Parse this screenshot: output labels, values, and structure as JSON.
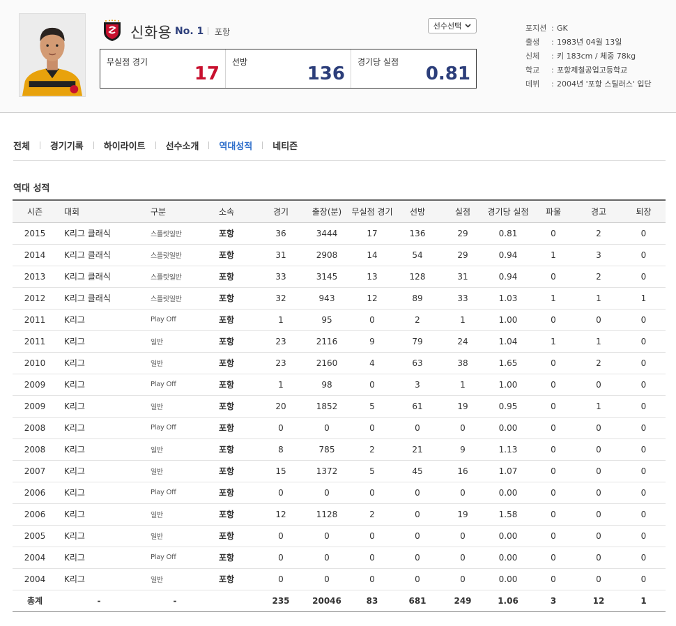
{
  "player": {
    "name": "신화용",
    "number": "No. 1",
    "team": "포항",
    "select_label": "선수선택"
  },
  "summary": [
    {
      "label": "무실점 경기",
      "value": "17"
    },
    {
      "label": "선방",
      "value": "136"
    },
    {
      "label": "경기당 실점",
      "value": "0.81"
    }
  ],
  "profile": [
    {
      "key": "포지션",
      "value": "GK"
    },
    {
      "key": "출생",
      "value": "1983년 04월 13일"
    },
    {
      "key": "신체",
      "value": "키 183cm / 체중 78kg"
    },
    {
      "key": "학교",
      "value": "포항제철공업고등학교"
    },
    {
      "key": "데뷔",
      "value": "2004년 '포항 스틸러스' 입단"
    }
  ],
  "tabs": [
    "전체",
    "경기기록",
    "하이라이트",
    "선수소개",
    "역대성적",
    "네티즌"
  ],
  "active_tab": "역대성적",
  "section_title": "역대 성적",
  "colors": {
    "accent_blue": "#2c3e7a",
    "accent_red": "#c8102e",
    "active_tab": "#2f6fcb"
  },
  "table": {
    "headers": [
      "시즌",
      "대회",
      "구분",
      "소속",
      "경기",
      "출장(분)",
      "무실점 경기",
      "선방",
      "실점",
      "경기당 실점",
      "파울",
      "경고",
      "퇴장"
    ],
    "rows": [
      [
        "2015",
        "K리그 클래식",
        "스플릿일반",
        "포항",
        "36",
        "3444",
        "17",
        "136",
        "29",
        "0.81",
        "0",
        "2",
        "0"
      ],
      [
        "2014",
        "K리그 클래식",
        "스플릿일반",
        "포항",
        "31",
        "2908",
        "14",
        "54",
        "29",
        "0.94",
        "1",
        "3",
        "0"
      ],
      [
        "2013",
        "K리그 클래식",
        "스플릿일반",
        "포항",
        "33",
        "3145",
        "13",
        "128",
        "31",
        "0.94",
        "0",
        "2",
        "0"
      ],
      [
        "2012",
        "K리그 클래식",
        "스플릿일반",
        "포항",
        "32",
        "943",
        "12",
        "89",
        "33",
        "1.03",
        "1",
        "1",
        "1"
      ],
      [
        "2011",
        "K리그",
        "Play Off",
        "포항",
        "1",
        "95",
        "0",
        "2",
        "1",
        "1.00",
        "0",
        "0",
        "0"
      ],
      [
        "2011",
        "K리그",
        "일반",
        "포항",
        "23",
        "2116",
        "9",
        "79",
        "24",
        "1.04",
        "1",
        "1",
        "0"
      ],
      [
        "2010",
        "K리그",
        "일반",
        "포항",
        "23",
        "2160",
        "4",
        "63",
        "38",
        "1.65",
        "0",
        "2",
        "0"
      ],
      [
        "2009",
        "K리그",
        "Play Off",
        "포항",
        "1",
        "98",
        "0",
        "3",
        "1",
        "1.00",
        "0",
        "0",
        "0"
      ],
      [
        "2009",
        "K리그",
        "일반",
        "포항",
        "20",
        "1852",
        "5",
        "61",
        "19",
        "0.95",
        "0",
        "1",
        "0"
      ],
      [
        "2008",
        "K리그",
        "Play Off",
        "포항",
        "0",
        "0",
        "0",
        "0",
        "0",
        "0.00",
        "0",
        "0",
        "0"
      ],
      [
        "2008",
        "K리그",
        "일반",
        "포항",
        "8",
        "785",
        "2",
        "21",
        "9",
        "1.13",
        "0",
        "0",
        "0"
      ],
      [
        "2007",
        "K리그",
        "일반",
        "포항",
        "15",
        "1372",
        "5",
        "45",
        "16",
        "1.07",
        "0",
        "0",
        "0"
      ],
      [
        "2006",
        "K리그",
        "Play Off",
        "포항",
        "0",
        "0",
        "0",
        "0",
        "0",
        "0.00",
        "0",
        "0",
        "0"
      ],
      [
        "2006",
        "K리그",
        "일반",
        "포항",
        "12",
        "1128",
        "2",
        "0",
        "19",
        "1.58",
        "0",
        "0",
        "0"
      ],
      [
        "2005",
        "K리그",
        "일반",
        "포항",
        "0",
        "0",
        "0",
        "0",
        "0",
        "0.00",
        "0",
        "0",
        "0"
      ],
      [
        "2004",
        "K리그",
        "Play Off",
        "포항",
        "0",
        "0",
        "0",
        "0",
        "0",
        "0.00",
        "0",
        "0",
        "0"
      ],
      [
        "2004",
        "K리그",
        "일반",
        "포항",
        "0",
        "0",
        "0",
        "0",
        "0",
        "0.00",
        "0",
        "0",
        "0"
      ]
    ],
    "total": [
      "총계",
      "-",
      "-",
      "",
      "235",
      "20046",
      "83",
      "681",
      "249",
      "1.06",
      "3",
      "12",
      "1"
    ]
  }
}
